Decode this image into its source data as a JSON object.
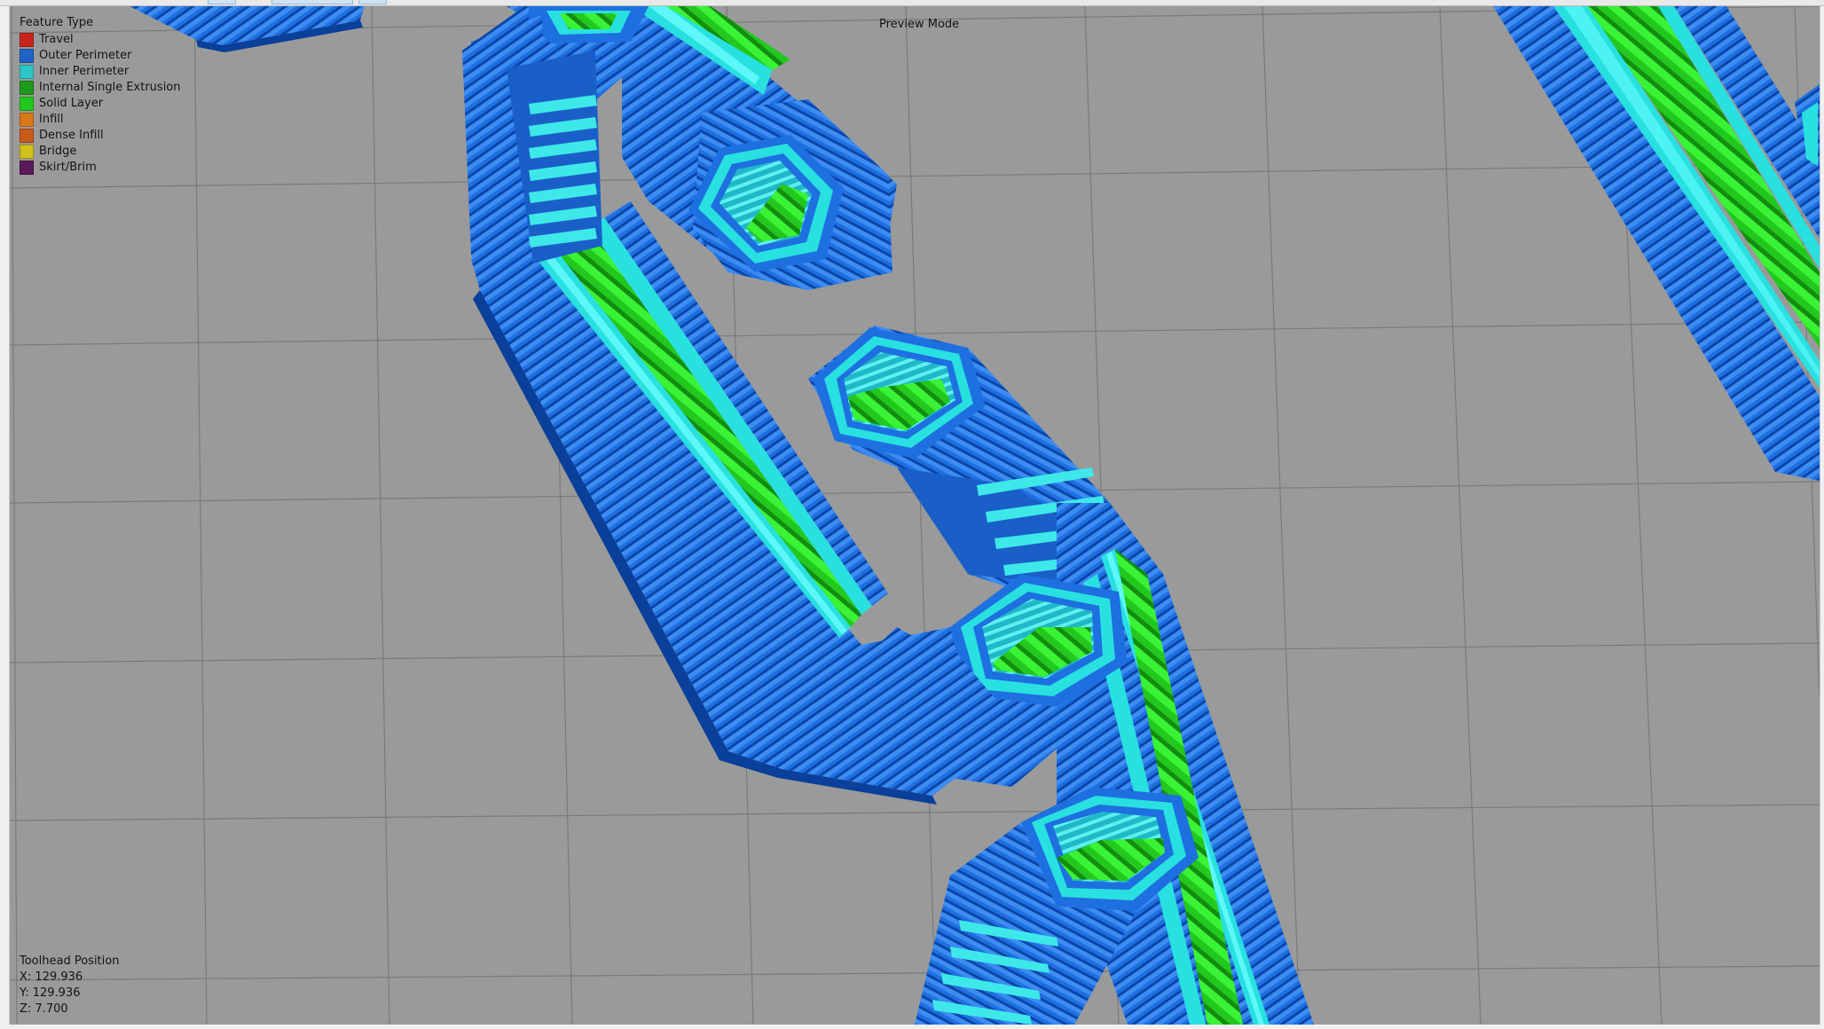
{
  "legend": {
    "title": "Feature Type",
    "items": [
      {
        "label": "Travel",
        "color": "#c8241c"
      },
      {
        "label": "Outer Perimeter",
        "color": "#1f63c6"
      },
      {
        "label": "Inner Perimeter",
        "color": "#2cc6c6"
      },
      {
        "label": "Internal Single Extrusion",
        "color": "#1e9a1e"
      },
      {
        "label": "Solid Layer",
        "color": "#22c81e"
      },
      {
        "label": "Infill",
        "color": "#d9781a"
      },
      {
        "label": "Dense Infill",
        "color": "#c85a1a"
      },
      {
        "label": "Bridge",
        "color": "#d0c21a"
      },
      {
        "label": "Skirt/Brim",
        "color": "#5a1a5a"
      }
    ]
  },
  "mode_label": "Preview Mode",
  "toolhead": {
    "title": "Toolhead Position",
    "x": "X: 129.936",
    "y": "Y: 129.936",
    "z": "Z: 7.700"
  },
  "colors": {
    "background": "#9a9a9a",
    "grid": "#7e7e7e",
    "outer_perimeter": "#1e6fe0",
    "outer_perimeter_dark": "#0a3f9a",
    "inner_perimeter": "#28e0e0",
    "solid_layer": "#2ee02a",
    "solid_layer_dark": "#178a14"
  }
}
